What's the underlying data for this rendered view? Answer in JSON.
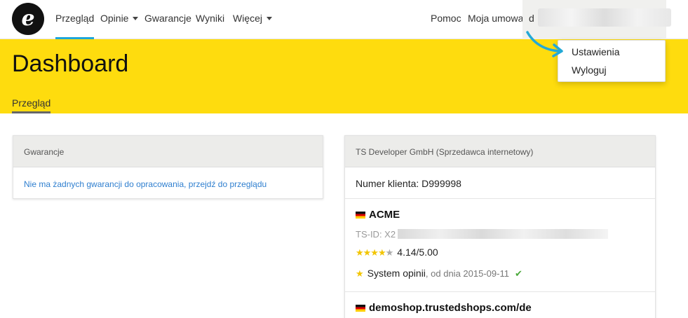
{
  "nav": {
    "logo_letter": "e",
    "items": [
      {
        "label": "Przegląd"
      },
      {
        "label": "Opinie"
      },
      {
        "label": "Gwarancje"
      },
      {
        "label": "Wyniki"
      },
      {
        "label": "Więcej"
      }
    ],
    "right": {
      "help": "Pomoc",
      "contract": "Moja umowa",
      "user_initial": "d"
    }
  },
  "dropdown": {
    "items": [
      {
        "label": "Ustawienia"
      },
      {
        "label": "Wyloguj"
      }
    ]
  },
  "header": {
    "title": "Dashboard",
    "subtab": "Przegląd"
  },
  "guarantee_card": {
    "title": "Gwarancje",
    "link": "Nie ma żadnych gwarancji do opracowania, przejdź do przeglądu"
  },
  "seller_card": {
    "title": "TS Developer GmbH (Sprzedawca internetowy)",
    "customer_number": "Numer klienta: D999998",
    "shops": [
      {
        "name": "ACME",
        "tsid_prefix": "TS-ID: X2",
        "stars_filled": "★★★★",
        "stars_empty": "★",
        "rating": "4.14/5.00",
        "system_label": "System opinii",
        "since": ", od dnia 2015-09-11"
      },
      {
        "name": "demoshop.trustedshops.com/de"
      }
    ]
  },
  "colors": {
    "accent": "#1fa6d8",
    "header_yellow": "#fedc0e",
    "link": "#2f7fcf",
    "check": "#4aa83a"
  }
}
